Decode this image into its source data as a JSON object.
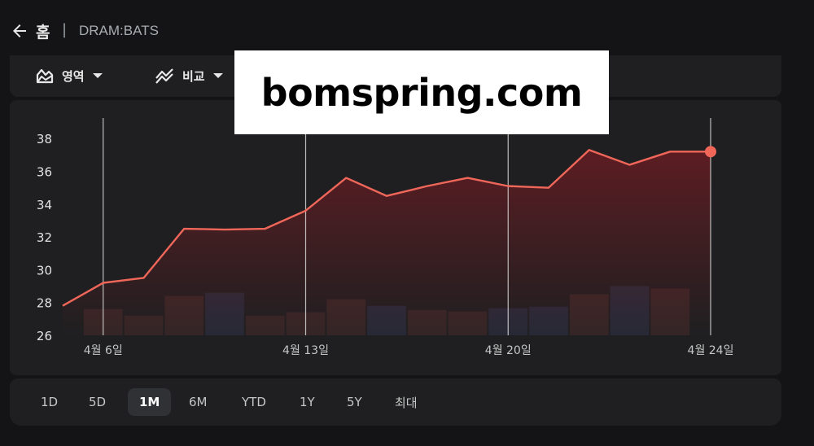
{
  "header": {
    "home_label": "홈",
    "separator": "|",
    "ticker": "DRAM:BATS"
  },
  "toolbar": {
    "area_label": "영역",
    "compare_label": "비교"
  },
  "watermark": "bomspring.com",
  "ranges": [
    {
      "label": "1D",
      "active": false
    },
    {
      "label": "5D",
      "active": false
    },
    {
      "label": "1M",
      "active": true
    },
    {
      "label": "6M",
      "active": false
    },
    {
      "label": "YTD",
      "active": false
    },
    {
      "label": "1Y",
      "active": false
    },
    {
      "label": "5Y",
      "active": false
    },
    {
      "label": "최대",
      "active": false
    }
  ],
  "colors": {
    "line": "#f0675a",
    "area_top": "#6b1c22",
    "volume_down": "#7a3a36",
    "volume_up": "#434a7a",
    "gridline": "#d8d8d8"
  },
  "chart_data": {
    "type": "area",
    "title": "",
    "xlabel": "",
    "ylabel": "",
    "ylim": [
      26,
      39
    ],
    "y_ticks": [
      "26",
      "28",
      "30",
      "32",
      "34",
      "36",
      "38"
    ],
    "x_ticks": [
      {
        "label": "4월 6일",
        "index": 1
      },
      {
        "label": "4월 13일",
        "index": 6
      },
      {
        "label": "4월 20일",
        "index": 11
      },
      {
        "label": "4월 24일",
        "index": 16
      }
    ],
    "price": [
      27.8,
      29.2,
      29.5,
      32.5,
      32.45,
      32.5,
      33.6,
      35.6,
      34.5,
      35.1,
      35.6,
      35.1,
      35.0,
      37.3,
      36.4,
      37.2,
      37.2
    ],
    "volume": [
      {
        "index": 1,
        "value": 27.6,
        "dir": "down"
      },
      {
        "index": 2,
        "value": 27.2,
        "dir": "down"
      },
      {
        "index": 3,
        "value": 28.4,
        "dir": "down"
      },
      {
        "index": 4,
        "value": 28.6,
        "dir": "up"
      },
      {
        "index": 5,
        "value": 27.2,
        "dir": "down"
      },
      {
        "index": 6,
        "value": 27.4,
        "dir": "down"
      },
      {
        "index": 7,
        "value": 28.2,
        "dir": "down"
      },
      {
        "index": 8,
        "value": 27.8,
        "dir": "up"
      },
      {
        "index": 9,
        "value": 27.55,
        "dir": "down"
      },
      {
        "index": 10,
        "value": 27.45,
        "dir": "down"
      },
      {
        "index": 11,
        "value": 27.65,
        "dir": "up"
      },
      {
        "index": 12,
        "value": 27.75,
        "dir": "up"
      },
      {
        "index": 13,
        "value": 28.5,
        "dir": "down"
      },
      {
        "index": 14,
        "value": 29.0,
        "dir": "up"
      },
      {
        "index": 15,
        "value": 28.85,
        "dir": "down"
      }
    ],
    "grid": false,
    "legend": "none"
  }
}
